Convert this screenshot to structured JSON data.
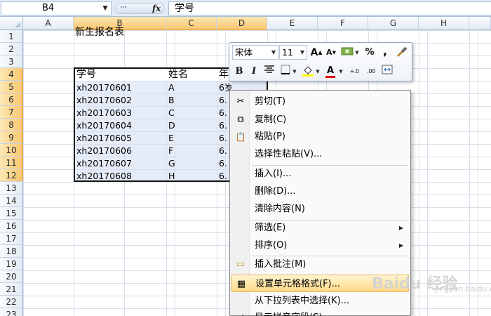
{
  "formula_bar": {
    "name_box": "B4",
    "fx_label": "fx",
    "formula": "学号"
  },
  "columns": [
    "A",
    "B",
    "C",
    "D",
    "E",
    "F",
    "G",
    "H"
  ],
  "rows": [
    "1",
    "2",
    "3",
    "4",
    "5",
    "6",
    "7",
    "8",
    "9",
    "10",
    "11",
    "12",
    "13",
    "14",
    "15",
    "16",
    "17",
    "18",
    "19",
    "20",
    "21",
    "22",
    "23"
  ],
  "sheet": {
    "title": "新生报名表",
    "header": [
      "学号",
      "姓名",
      "年"
    ],
    "records": [
      {
        "id": "xh20170601",
        "name": "A",
        "age": "6岁"
      },
      {
        "id": "xh20170602",
        "name": "B",
        "age": "6."
      },
      {
        "id": "xh20170603",
        "name": "C",
        "age": "6."
      },
      {
        "id": "xh20170604",
        "name": "D",
        "age": "6."
      },
      {
        "id": "xh20170605",
        "name": "E",
        "age": "6."
      },
      {
        "id": "xh20170606",
        "name": "F",
        "age": "6."
      },
      {
        "id": "xh20170607",
        "name": "G",
        "age": "6."
      },
      {
        "id": "xh20170608",
        "name": "H",
        "age": "6."
      }
    ]
  },
  "mini_toolbar": {
    "font": "宋体",
    "size": "11",
    "grow_font": "A",
    "shrink_font": "A",
    "percent": "%",
    "comma": ",",
    "bold": "B",
    "italic": "I",
    "font_color_letter": "A",
    "inc_decimal": "+.0",
    "dec_decimal": ".00"
  },
  "context_menu": {
    "items": [
      {
        "label": "剪切(T)",
        "icon": "scissors-icon",
        "glyph": "✂"
      },
      {
        "label": "复制(C)",
        "icon": "copy-icon",
        "glyph": "⧉"
      },
      {
        "label": "粘贴(P)",
        "icon": "paste-icon",
        "glyph": "📋"
      },
      {
        "label": "选择性粘贴(V)...",
        "icon": "",
        "glyph": ""
      },
      {
        "label": "插入(I)...",
        "icon": "",
        "glyph": ""
      },
      {
        "label": "删除(D)...",
        "icon": "",
        "glyph": ""
      },
      {
        "label": "清除内容(N)",
        "icon": "",
        "glyph": ""
      },
      {
        "label": "筛选(E)",
        "icon": "",
        "glyph": ""
      },
      {
        "label": "排序(O)",
        "icon": "",
        "glyph": ""
      },
      {
        "label": "插入批注(M)",
        "icon": "comment-icon",
        "glyph": "▭"
      },
      {
        "label": "设置单元格格式(F)...",
        "icon": "format-cells-icon",
        "glyph": "▦"
      },
      {
        "label": "从下拉列表中选择(K)...",
        "icon": "",
        "glyph": ""
      },
      {
        "label": "显示拼音字段(S)",
        "icon": "phonetic-icon",
        "glyph": "wén"
      }
    ],
    "submenu_arrow": "▶"
  },
  "watermark": {
    "brand": "Baidu 经验",
    "url": "jingyan.baidu.com"
  }
}
